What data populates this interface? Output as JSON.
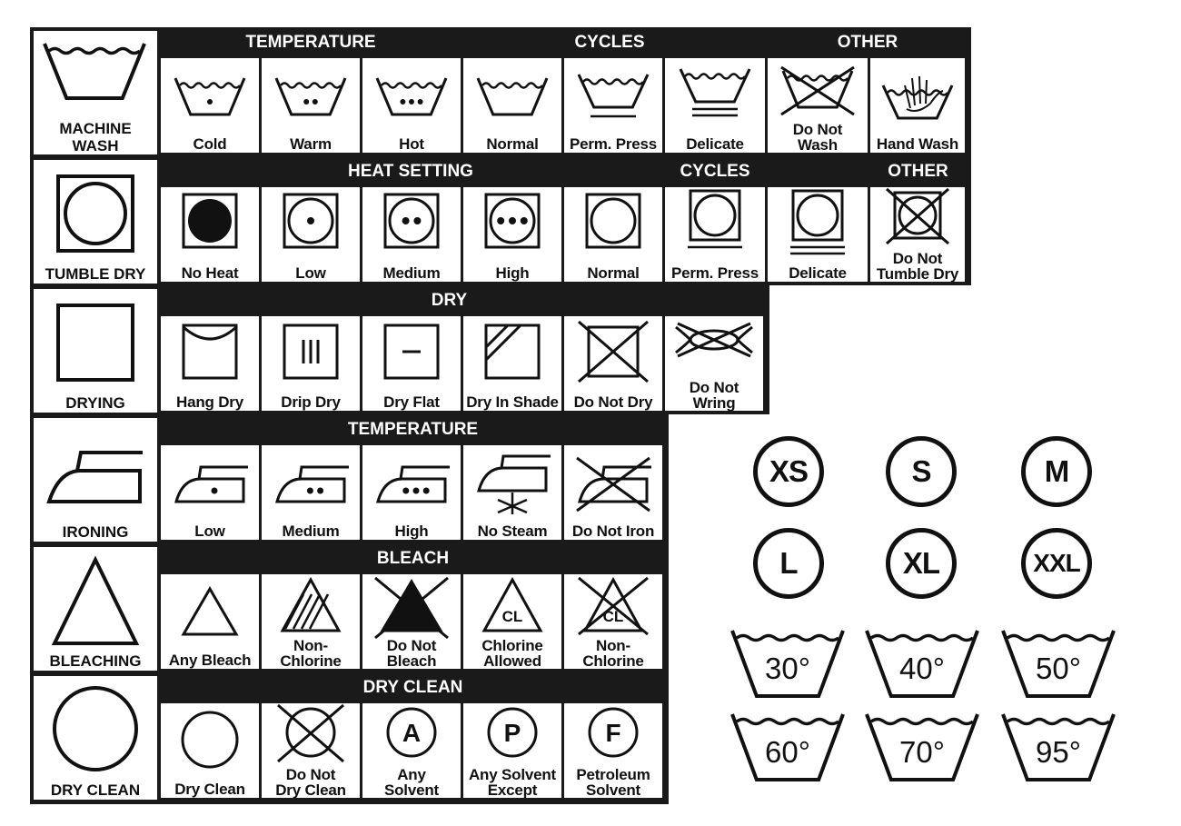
{
  "rows": [
    {
      "key": "machine-wash",
      "main_lines": [
        "MACHINE",
        "WASH"
      ],
      "headers": [
        "TEMPERATURE",
        "CYCLES",
        "OTHER"
      ],
      "cells": [
        {
          "icon": "wash-tub-1-dot-icon",
          "lines": [
            "Cold"
          ]
        },
        {
          "icon": "wash-tub-2-dots-icon",
          "lines": [
            "Warm"
          ]
        },
        {
          "icon": "wash-tub-3-dots-icon",
          "lines": [
            "Hot"
          ]
        },
        {
          "icon": "wash-tub-icon",
          "lines": [
            "Normal"
          ]
        },
        {
          "icon": "wash-tub-1-bar-icon",
          "lines": [
            "Perm. Press"
          ]
        },
        {
          "icon": "wash-tub-2-bars-icon",
          "lines": [
            "Delicate"
          ]
        },
        {
          "icon": "wash-tub-crossed-icon",
          "lines": [
            "Do Not",
            "Wash"
          ]
        },
        {
          "icon": "wash-tub-hand-icon",
          "lines": [
            "Hand Wash"
          ]
        }
      ]
    },
    {
      "key": "tumble-dry",
      "main_lines": [
        "TUMBLE DRY"
      ],
      "headers": [
        "HEAT SETTING",
        "CYCLES",
        "OTHER"
      ],
      "cells": [
        {
          "icon": "tumble-filled-icon",
          "lines": [
            "No Heat"
          ]
        },
        {
          "icon": "tumble-1-dot-icon",
          "lines": [
            "Low"
          ]
        },
        {
          "icon": "tumble-2-dots-icon",
          "lines": [
            "Medium"
          ]
        },
        {
          "icon": "tumble-3-dots-icon",
          "lines": [
            "High"
          ]
        },
        {
          "icon": "tumble-icon",
          "lines": [
            "Normal"
          ]
        },
        {
          "icon": "tumble-1-bar-icon",
          "lines": [
            "Perm. Press"
          ]
        },
        {
          "icon": "tumble-2-bars-icon",
          "lines": [
            "Delicate"
          ]
        },
        {
          "icon": "tumble-crossed-icon",
          "lines": [
            "Do Not",
            "Tumble Dry"
          ]
        }
      ]
    },
    {
      "key": "drying",
      "main_lines": [
        "DRYING"
      ],
      "headers": [
        "DRY"
      ],
      "cells": [
        {
          "icon": "hang-dry-icon",
          "lines": [
            "Hang Dry"
          ]
        },
        {
          "icon": "drip-dry-icon",
          "lines": [
            "Drip Dry"
          ]
        },
        {
          "icon": "dry-flat-icon",
          "lines": [
            "Dry Flat"
          ]
        },
        {
          "icon": "dry-in-shade-icon",
          "lines": [
            "Dry In Shade"
          ]
        },
        {
          "icon": "do-not-dry-icon",
          "lines": [
            "Do Not Dry"
          ]
        },
        {
          "icon": "do-not-wring-icon",
          "lines": [
            "Do Not",
            "Wring"
          ]
        }
      ]
    },
    {
      "key": "ironing",
      "main_lines": [
        "IRONING"
      ],
      "headers": [
        "TEMPERATURE"
      ],
      "cells": [
        {
          "icon": "iron-1-dot-icon",
          "lines": [
            "Low"
          ]
        },
        {
          "icon": "iron-2-dots-icon",
          "lines": [
            "Medium"
          ]
        },
        {
          "icon": "iron-3-dots-icon",
          "lines": [
            "High"
          ]
        },
        {
          "icon": "iron-no-steam-icon",
          "lines": [
            "No Steam"
          ]
        },
        {
          "icon": "iron-crossed-icon",
          "lines": [
            "Do Not Iron"
          ]
        }
      ]
    },
    {
      "key": "bleaching",
      "main_lines": [
        "BLEACHING"
      ],
      "headers": [
        "BLEACH"
      ],
      "cells": [
        {
          "icon": "triangle-icon",
          "lines": [
            "Any Bleach"
          ]
        },
        {
          "icon": "triangle-striped-icon",
          "lines": [
            "Non-",
            "Chlorine"
          ]
        },
        {
          "icon": "triangle-filled-crossed-icon",
          "lines": [
            "Do Not",
            "Bleach"
          ]
        },
        {
          "icon": "triangle-cl-icon",
          "lines": [
            "Chlorine",
            "Allowed"
          ],
          "mark": "CL"
        },
        {
          "icon": "triangle-cl-crossed-icon",
          "lines": [
            "Non-",
            "Chlorine"
          ],
          "mark": "CL"
        }
      ]
    },
    {
      "key": "dry-clean",
      "main_lines": [
        "DRY CLEAN"
      ],
      "headers": [
        "DRY CLEAN"
      ],
      "cells": [
        {
          "icon": "circle-icon",
          "lines": [
            "Dry Clean"
          ]
        },
        {
          "icon": "circle-crossed-icon",
          "lines": [
            "Do Not",
            "Dry Clean"
          ]
        },
        {
          "icon": "circle-a-icon",
          "lines": [
            "Any",
            "Solvent"
          ],
          "mark": "A"
        },
        {
          "icon": "circle-p-icon",
          "lines": [
            "Any Solvent",
            "Except"
          ],
          "mark": "P"
        },
        {
          "icon": "circle-f-icon",
          "lines": [
            "Petroleum",
            "Solvent"
          ],
          "mark": "F"
        }
      ]
    }
  ],
  "sizes": [
    "XS",
    "S",
    "M",
    "L",
    "XL",
    "XXL"
  ],
  "temperatures": [
    "30°",
    "40°",
    "50°",
    "60°",
    "70°",
    "95°"
  ],
  "colors": {
    "ink": "#111111",
    "band": "#1a1a1a",
    "paper": "#ffffff"
  }
}
